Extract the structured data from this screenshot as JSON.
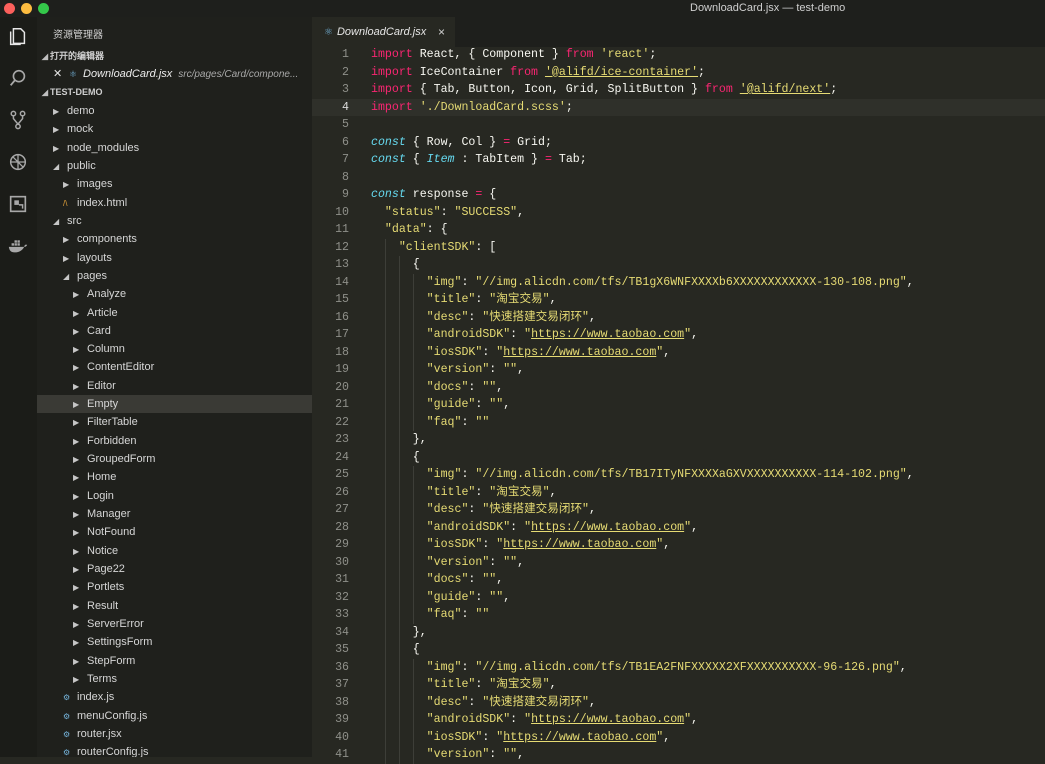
{
  "window": {
    "title": "DownloadCard.jsx — test-demo"
  },
  "sidebar": {
    "explorer_title": "资源管理器",
    "open_editors_label": "打开的编辑器",
    "open_file": {
      "name": "DownloadCard.jsx",
      "path": "src/pages/Card/compone..."
    },
    "project_label": "TEST-DEMO",
    "tree": [
      {
        "label": "demo",
        "kind": "folder",
        "depth": 0,
        "open": false
      },
      {
        "label": "mock",
        "kind": "folder",
        "depth": 0,
        "open": false
      },
      {
        "label": "node_modules",
        "kind": "folder",
        "depth": 0,
        "open": false
      },
      {
        "label": "public",
        "kind": "folder",
        "depth": 0,
        "open": true
      },
      {
        "label": "images",
        "kind": "folder",
        "depth": 1,
        "open": false
      },
      {
        "label": "index.html",
        "kind": "html",
        "depth": 1
      },
      {
        "label": "src",
        "kind": "folder",
        "depth": 0,
        "open": true
      },
      {
        "label": "components",
        "kind": "folder",
        "depth": 1,
        "open": false
      },
      {
        "label": "layouts",
        "kind": "folder",
        "depth": 1,
        "open": false
      },
      {
        "label": "pages",
        "kind": "folder",
        "depth": 1,
        "open": true
      },
      {
        "label": "Analyze",
        "kind": "folder",
        "depth": 2,
        "open": false
      },
      {
        "label": "Article",
        "kind": "folder",
        "depth": 2,
        "open": false
      },
      {
        "label": "Card",
        "kind": "folder",
        "depth": 2,
        "open": false
      },
      {
        "label": "Column",
        "kind": "folder",
        "depth": 2,
        "open": false
      },
      {
        "label": "ContentEditor",
        "kind": "folder",
        "depth": 2,
        "open": false
      },
      {
        "label": "Editor",
        "kind": "folder",
        "depth": 2,
        "open": false
      },
      {
        "label": "Empty",
        "kind": "folder",
        "depth": 2,
        "open": false,
        "selected": true
      },
      {
        "label": "FilterTable",
        "kind": "folder",
        "depth": 2,
        "open": false
      },
      {
        "label": "Forbidden",
        "kind": "folder",
        "depth": 2,
        "open": false
      },
      {
        "label": "GroupedForm",
        "kind": "folder",
        "depth": 2,
        "open": false
      },
      {
        "label": "Home",
        "kind": "folder",
        "depth": 2,
        "open": false
      },
      {
        "label": "Login",
        "kind": "folder",
        "depth": 2,
        "open": false
      },
      {
        "label": "Manager",
        "kind": "folder",
        "depth": 2,
        "open": false
      },
      {
        "label": "NotFound",
        "kind": "folder",
        "depth": 2,
        "open": false
      },
      {
        "label": "Notice",
        "kind": "folder",
        "depth": 2,
        "open": false
      },
      {
        "label": "Page22",
        "kind": "folder",
        "depth": 2,
        "open": false
      },
      {
        "label": "Portlets",
        "kind": "folder",
        "depth": 2,
        "open": false
      },
      {
        "label": "Result",
        "kind": "folder",
        "depth": 2,
        "open": false
      },
      {
        "label": "ServerError",
        "kind": "folder",
        "depth": 2,
        "open": false
      },
      {
        "label": "SettingsForm",
        "kind": "folder",
        "depth": 2,
        "open": false
      },
      {
        "label": "StepForm",
        "kind": "folder",
        "depth": 2,
        "open": false
      },
      {
        "label": "Terms",
        "kind": "folder",
        "depth": 2,
        "open": false
      },
      {
        "label": "index.js",
        "kind": "js",
        "depth": 1
      },
      {
        "label": "menuConfig.js",
        "kind": "js",
        "depth": 1
      },
      {
        "label": "router.jsx",
        "kind": "js",
        "depth": 1
      },
      {
        "label": "routerConfig.js",
        "kind": "js",
        "depth": 1
      }
    ]
  },
  "editor": {
    "tab": {
      "label": "DownloadCard.jsx",
      "close": "×"
    },
    "current_line": 4,
    "lines": [
      [
        [
          "k",
          "import"
        ],
        [
          "p",
          " React, { Component } "
        ],
        [
          "k",
          "from"
        ],
        [
          "s",
          " 'react'"
        ],
        [
          "p",
          ";"
        ]
      ],
      [
        [
          "k",
          "import"
        ],
        [
          "p",
          " IceContainer "
        ],
        [
          "k",
          "from"
        ],
        [
          "p",
          " "
        ],
        [
          "u",
          "'@alifd/ice-container'"
        ],
        [
          "p",
          ";"
        ]
      ],
      [
        [
          "k",
          "import"
        ],
        [
          "p",
          " { Tab, Button, Icon, Grid, SplitButton } "
        ],
        [
          "k",
          "from"
        ],
        [
          "p",
          " "
        ],
        [
          "u",
          "'@alifd/next'"
        ],
        [
          "p",
          ";"
        ]
      ],
      [
        [
          "k",
          "import"
        ],
        [
          "s",
          " './DownloadCard.scss'"
        ],
        [
          "p",
          ";"
        ]
      ],
      [],
      [
        [
          "c",
          "const"
        ],
        [
          "p",
          " { Row, Col } "
        ],
        [
          "k",
          "="
        ],
        [
          "p",
          " Grid;"
        ]
      ],
      [
        [
          "c",
          "const"
        ],
        [
          "p",
          " { "
        ],
        [
          "c",
          "Item"
        ],
        [
          "p",
          " : TabItem } "
        ],
        [
          "k",
          "="
        ],
        [
          "p",
          " Tab;"
        ]
      ],
      [],
      [
        [
          "c",
          "const"
        ],
        [
          "p",
          " response "
        ],
        [
          "k",
          "="
        ],
        [
          "p",
          " {"
        ]
      ],
      [
        [
          "p",
          "  "
        ],
        [
          "q",
          "\"status\""
        ],
        [
          "p",
          ": "
        ],
        [
          "q",
          "\"SUCCESS\""
        ],
        [
          "p",
          ","
        ]
      ],
      [
        [
          "p",
          "  "
        ],
        [
          "q",
          "\"data\""
        ],
        [
          "p",
          ": {"
        ]
      ],
      [
        [
          "p",
          "    "
        ],
        [
          "q",
          "\"clientSDK\""
        ],
        [
          "p",
          ": ["
        ]
      ],
      [
        [
          "p",
          "      {"
        ]
      ],
      [
        [
          "p",
          "        "
        ],
        [
          "q",
          "\"img\""
        ],
        [
          "p",
          ": "
        ],
        [
          "q",
          "\"//img.alicdn.com/tfs/TB1gX6WNFXXXXb6XXXXXXXXXXXX-130-108.png\""
        ],
        [
          "p",
          ","
        ]
      ],
      [
        [
          "p",
          "        "
        ],
        [
          "q",
          "\"title\""
        ],
        [
          "p",
          ": "
        ],
        [
          "q",
          "\"淘宝交易\""
        ],
        [
          "p",
          ","
        ]
      ],
      [
        [
          "p",
          "        "
        ],
        [
          "q",
          "\"desc\""
        ],
        [
          "p",
          ": "
        ],
        [
          "q",
          "\"快速搭建交易闭环\""
        ],
        [
          "p",
          ","
        ]
      ],
      [
        [
          "p",
          "        "
        ],
        [
          "q",
          "\"androidSDK\""
        ],
        [
          "p",
          ": "
        ],
        [
          "q",
          "\""
        ],
        [
          "u",
          "https://www.taobao.com"
        ],
        [
          "q",
          "\""
        ],
        [
          "p",
          ","
        ]
      ],
      [
        [
          "p",
          "        "
        ],
        [
          "q",
          "\"iosSDK\""
        ],
        [
          "p",
          ": "
        ],
        [
          "q",
          "\""
        ],
        [
          "u",
          "https://www.taobao.com"
        ],
        [
          "q",
          "\""
        ],
        [
          "p",
          ","
        ]
      ],
      [
        [
          "p",
          "        "
        ],
        [
          "q",
          "\"version\""
        ],
        [
          "p",
          ": "
        ],
        [
          "q",
          "\"\""
        ],
        [
          "p",
          ","
        ]
      ],
      [
        [
          "p",
          "        "
        ],
        [
          "q",
          "\"docs\""
        ],
        [
          "p",
          ": "
        ],
        [
          "q",
          "\"\""
        ],
        [
          "p",
          ","
        ]
      ],
      [
        [
          "p",
          "        "
        ],
        [
          "q",
          "\"guide\""
        ],
        [
          "p",
          ": "
        ],
        [
          "q",
          "\"\""
        ],
        [
          "p",
          ","
        ]
      ],
      [
        [
          "p",
          "        "
        ],
        [
          "q",
          "\"faq\""
        ],
        [
          "p",
          ": "
        ],
        [
          "q",
          "\"\""
        ]
      ],
      [
        [
          "p",
          "      },"
        ]
      ],
      [
        [
          "p",
          "      {"
        ]
      ],
      [
        [
          "p",
          "        "
        ],
        [
          "q",
          "\"img\""
        ],
        [
          "p",
          ": "
        ],
        [
          "q",
          "\"//img.alicdn.com/tfs/TB17ITyNFXXXXaGXVXXXXXXXXXX-114-102.png\""
        ],
        [
          "p",
          ","
        ]
      ],
      [
        [
          "p",
          "        "
        ],
        [
          "q",
          "\"title\""
        ],
        [
          "p",
          ": "
        ],
        [
          "q",
          "\"淘宝交易\""
        ],
        [
          "p",
          ","
        ]
      ],
      [
        [
          "p",
          "        "
        ],
        [
          "q",
          "\"desc\""
        ],
        [
          "p",
          ": "
        ],
        [
          "q",
          "\"快速搭建交易闭环\""
        ],
        [
          "p",
          ","
        ]
      ],
      [
        [
          "p",
          "        "
        ],
        [
          "q",
          "\"androidSDK\""
        ],
        [
          "p",
          ": "
        ],
        [
          "q",
          "\""
        ],
        [
          "u",
          "https://www.taobao.com"
        ],
        [
          "q",
          "\""
        ],
        [
          "p",
          ","
        ]
      ],
      [
        [
          "p",
          "        "
        ],
        [
          "q",
          "\"iosSDK\""
        ],
        [
          "p",
          ": "
        ],
        [
          "q",
          "\""
        ],
        [
          "u",
          "https://www.taobao.com"
        ],
        [
          "q",
          "\""
        ],
        [
          "p",
          ","
        ]
      ],
      [
        [
          "p",
          "        "
        ],
        [
          "q",
          "\"version\""
        ],
        [
          "p",
          ": "
        ],
        [
          "q",
          "\"\""
        ],
        [
          "p",
          ","
        ]
      ],
      [
        [
          "p",
          "        "
        ],
        [
          "q",
          "\"docs\""
        ],
        [
          "p",
          ": "
        ],
        [
          "q",
          "\"\""
        ],
        [
          "p",
          ","
        ]
      ],
      [
        [
          "p",
          "        "
        ],
        [
          "q",
          "\"guide\""
        ],
        [
          "p",
          ": "
        ],
        [
          "q",
          "\"\""
        ],
        [
          "p",
          ","
        ]
      ],
      [
        [
          "p",
          "        "
        ],
        [
          "q",
          "\"faq\""
        ],
        [
          "p",
          ": "
        ],
        [
          "q",
          "\"\""
        ]
      ],
      [
        [
          "p",
          "      },"
        ]
      ],
      [
        [
          "p",
          "      {"
        ]
      ],
      [
        [
          "p",
          "        "
        ],
        [
          "q",
          "\"img\""
        ],
        [
          "p",
          ": "
        ],
        [
          "q",
          "\"//img.alicdn.com/tfs/TB1EA2FNFXXXXX2XFXXXXXXXXXX-96-126.png\""
        ],
        [
          "p",
          ","
        ]
      ],
      [
        [
          "p",
          "        "
        ],
        [
          "q",
          "\"title\""
        ],
        [
          "p",
          ": "
        ],
        [
          "q",
          "\"淘宝交易\""
        ],
        [
          "p",
          ","
        ]
      ],
      [
        [
          "p",
          "        "
        ],
        [
          "q",
          "\"desc\""
        ],
        [
          "p",
          ": "
        ],
        [
          "q",
          "\"快速搭建交易闭环\""
        ],
        [
          "p",
          ","
        ]
      ],
      [
        [
          "p",
          "        "
        ],
        [
          "q",
          "\"androidSDK\""
        ],
        [
          "p",
          ": "
        ],
        [
          "q",
          "\""
        ],
        [
          "u",
          "https://www.taobao.com"
        ],
        [
          "q",
          "\""
        ],
        [
          "p",
          ","
        ]
      ],
      [
        [
          "p",
          "        "
        ],
        [
          "q",
          "\"iosSDK\""
        ],
        [
          "p",
          ": "
        ],
        [
          "q",
          "\""
        ],
        [
          "u",
          "https://www.taobao.com"
        ],
        [
          "q",
          "\""
        ],
        [
          "p",
          ","
        ]
      ],
      [
        [
          "p",
          "        "
        ],
        [
          "q",
          "\"version\""
        ],
        [
          "p",
          ": "
        ],
        [
          "q",
          "\"\""
        ],
        [
          "p",
          ","
        ]
      ]
    ]
  },
  "colors": {
    "close_light": "#fc605c",
    "min_light": "#fdbc40",
    "max_light": "#34c84a"
  },
  "icons": [
    "files-icon",
    "search-icon",
    "source-control-icon",
    "debug-icon",
    "extensions-icon",
    "docker-icon"
  ]
}
